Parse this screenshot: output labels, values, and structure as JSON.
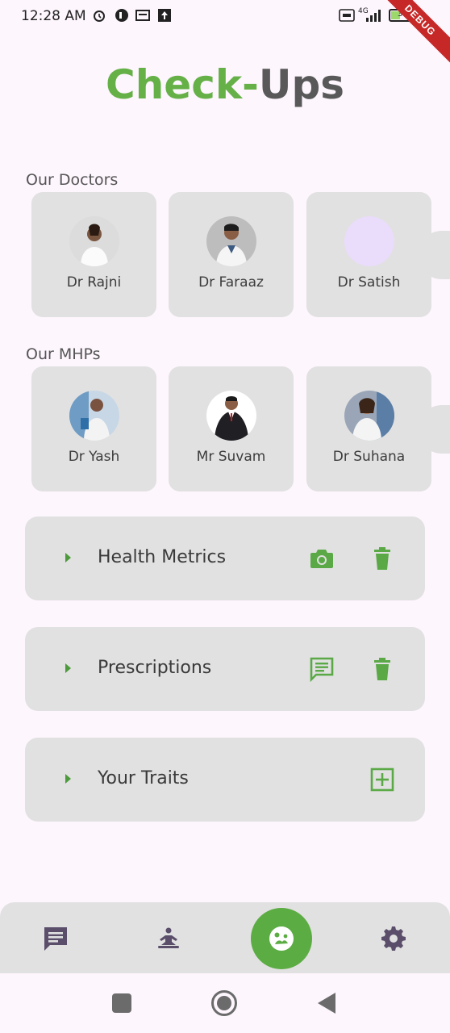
{
  "status": {
    "time": "12:28 AM",
    "battery": "36",
    "network": "4G",
    "debug": "DEBUG"
  },
  "title": {
    "part1": "Check-",
    "part2": "Ups"
  },
  "doctors": {
    "label": "Our Doctors",
    "items": [
      {
        "name": "Dr Rajni"
      },
      {
        "name": "Dr Faraaz"
      },
      {
        "name": "Dr Satish"
      }
    ]
  },
  "mhps": {
    "label": "Our MHPs",
    "items": [
      {
        "name": "Dr Yash"
      },
      {
        "name": "Mr Suvam"
      },
      {
        "name": "Dr Suhana"
      }
    ]
  },
  "panels": [
    {
      "label": "Health Metrics",
      "icons": [
        "camera-icon",
        "trash-icon"
      ]
    },
    {
      "label": "Prescriptions",
      "icons": [
        "message-icon",
        "trash-icon"
      ]
    },
    {
      "label": "Your Traits",
      "icons": [
        "add-box-icon"
      ]
    }
  ],
  "nav": {
    "icons": [
      "chat-icon",
      "meditation-icon",
      "check-ups-icon",
      "settings-icon"
    ]
  },
  "colors": {
    "accent": "#65b047",
    "card": "#e1e1e1",
    "background": "#fdf6fd"
  }
}
